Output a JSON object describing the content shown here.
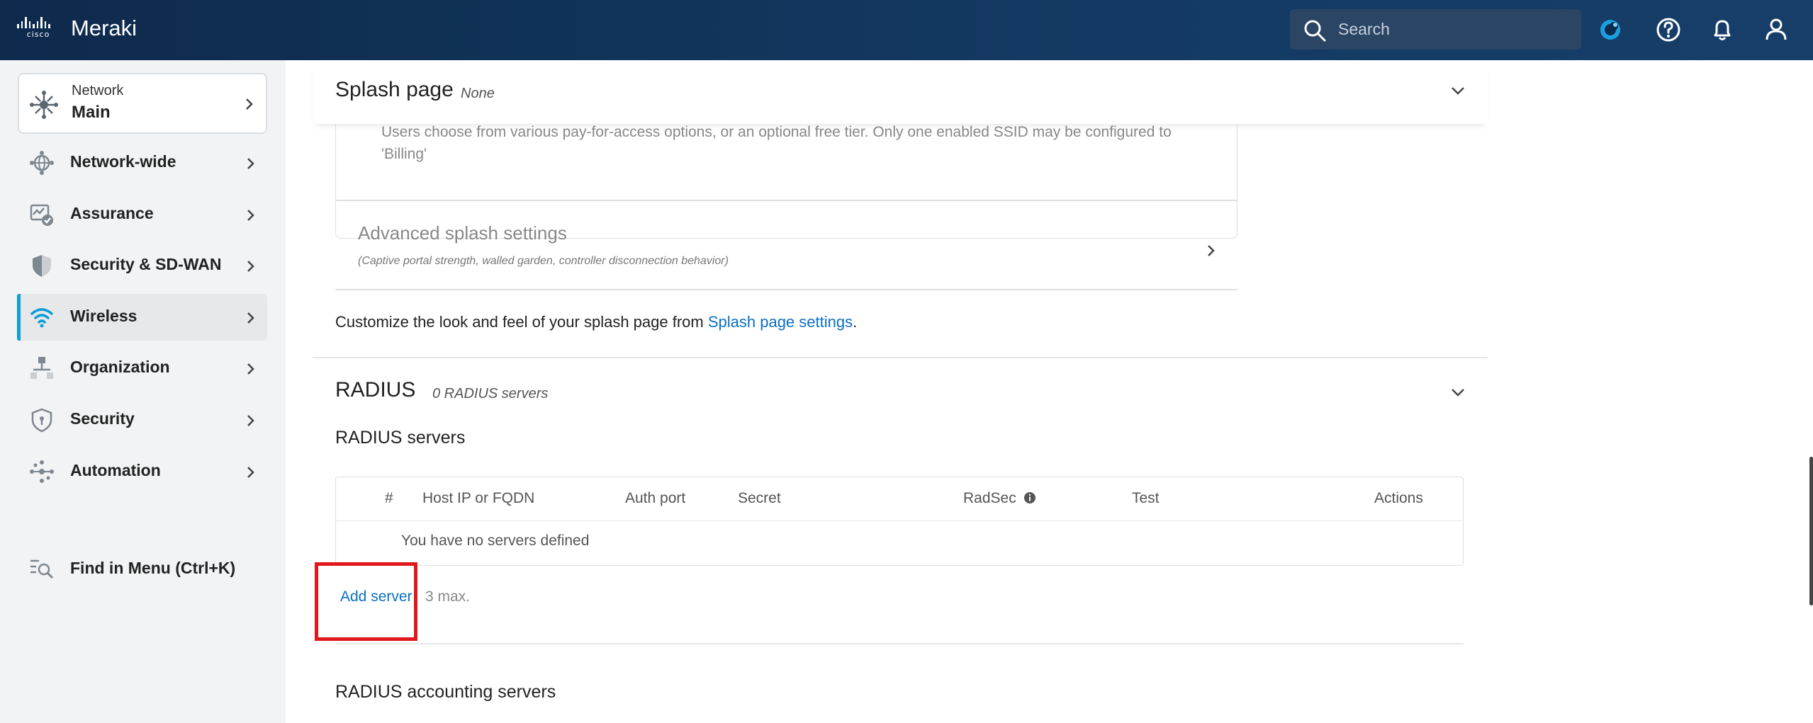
{
  "app": {
    "name": "Meraki",
    "logo_text": "cisco"
  },
  "search": {
    "placeholder": "Search"
  },
  "sidebar": {
    "network": {
      "label": "Network",
      "value": "Main"
    },
    "items": [
      {
        "label": "Network-wide",
        "icon": "network-wide-icon"
      },
      {
        "label": "Assurance",
        "icon": "assurance-icon"
      },
      {
        "label": "Security & SD-WAN",
        "icon": "security-sdwan-icon"
      },
      {
        "label": "Wireless",
        "icon": "wifi-icon",
        "active": true
      },
      {
        "label": "Organization",
        "icon": "organization-icon"
      },
      {
        "label": "Security",
        "icon": "shield-icon"
      },
      {
        "label": "Automation",
        "icon": "automation-icon"
      }
    ],
    "find_menu": "Find in Menu (Ctrl+K)"
  },
  "splash": {
    "title": "Splash page",
    "subtitle": "None",
    "billing_desc": "Users choose from various pay-for-access options, or an optional free tier. Only one enabled SSID may be configured to 'Billing'",
    "advanced_title": "Advanced splash settings",
    "advanced_sub": "(Captive portal strength, walled garden, controller disconnection behavior)",
    "customize_prefix": "Customize the look and feel of your splash page from ",
    "customize_link": "Splash page settings",
    "customize_suffix": "."
  },
  "radius": {
    "title": "RADIUS",
    "subtitle": "0 RADIUS servers",
    "servers_heading": "RADIUS servers",
    "columns": [
      "#",
      "Host IP or FQDN",
      "Auth port",
      "Secret",
      "RadSec",
      "Test",
      "Actions"
    ],
    "empty_message": "You have no servers defined",
    "add_server": "Add server",
    "max_note": "3 max.",
    "accounting_heading": "RADIUS accounting servers"
  },
  "colors": {
    "accent": "#0b6fc4",
    "active_bar": "#0e9ed8",
    "highlight": "#e0171b",
    "topbar": "#0e2a4d"
  }
}
